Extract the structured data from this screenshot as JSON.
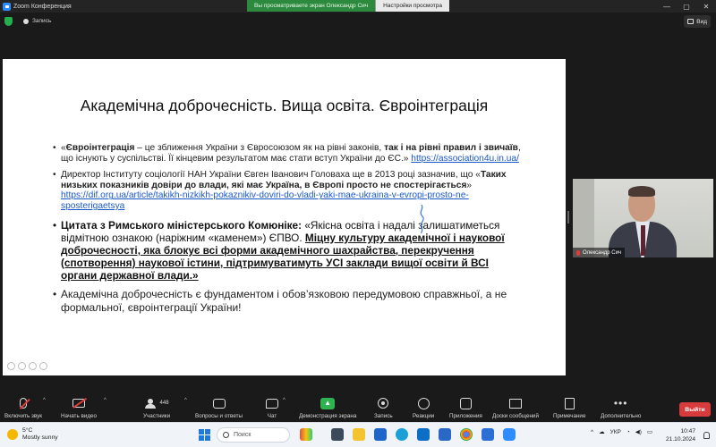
{
  "window": {
    "title": "Zoom Конференция",
    "banner_message": "Вы просматриваете экран Олександр Сич",
    "banner_option": "Настройки просмотра",
    "min": "—",
    "max": "▢",
    "close": "✕"
  },
  "meeting_bar": {
    "record_label": "Запись",
    "view_label": "Вид"
  },
  "slide": {
    "title": "Академічна доброчесність. Вища освіта. Євроінтеграція",
    "b1": {
      "quote_open": "«",
      "term": "Євроінтеграція",
      "text_a": " – це зближення України з Євросоюзом як на рівні законів, ",
      "bold_b": "так і на рівні правил і звичаїв",
      "text_c": ", що існують у суспільстві. Її кінцевим результатом має стати вступ України до ЄС.» ",
      "link": "https://association4u.in.ua/"
    },
    "b2": {
      "text_a": "Директор Інституту соціології НАН України Євген Іванович Головаха ще в 2013 році зазначив, що «",
      "bold_b": "Таких низьких показників довіри до влади, які має Україна, в Європі просто не спостерігається",
      "text_c": "» ",
      "link": "https://dif.org.ua/article/takikh-nizkikh-pokaznikiv-doviri-do-vladi-yaki-mae-ukraina-v-evropi-prosto-ne-sposterigaetsya"
    },
    "b3": {
      "bold_a": "Цитата з Римського міністерського Комюніке:",
      "text_b": " «Якісна освіта і надалі залишатиметься відмітною ознакою (наріжним «каменем») ЄПВО. ",
      "bold_c": "Міцну культуру академічної і наукової доброчесності, яка блокує всі форми академічного шахрайства, перекручення (спотворення) наукової істини, підтримуватимуть УСІ заклади вищої освіти й ВСІ органи державної влади.»"
    },
    "b4": {
      "text": " Академічна доброчесність є фундаментом і обов’язковою передумовою справжньої, а не формальної, євроінтеграції України!"
    }
  },
  "participant": {
    "name": "Олександр Сич"
  },
  "toolbar": {
    "mic": "Включить звук",
    "video": "Начать видео",
    "participants": "Участники",
    "participants_count": "448",
    "qa": "Вопросы и ответы",
    "chat": "Чат",
    "share": "Демонстрация экрана",
    "record": "Запись",
    "reactions": "Реакции",
    "apps": "Приложения",
    "whiteboard": "Доски сообщений",
    "notes": "Примечание",
    "more": "Дополнительно",
    "leave": "Выйти"
  },
  "taskbar": {
    "temp": "5°C",
    "weather": "Mostly sunny",
    "search": "Поиск",
    "lang": "УКР",
    "time": "10:47",
    "date": "21.10.2024"
  },
  "colors": {
    "share_green": "#2fb350",
    "leave_red": "#d83b3b",
    "link_blue": "#1a57c9",
    "banner_green": "#2c8a3e"
  }
}
